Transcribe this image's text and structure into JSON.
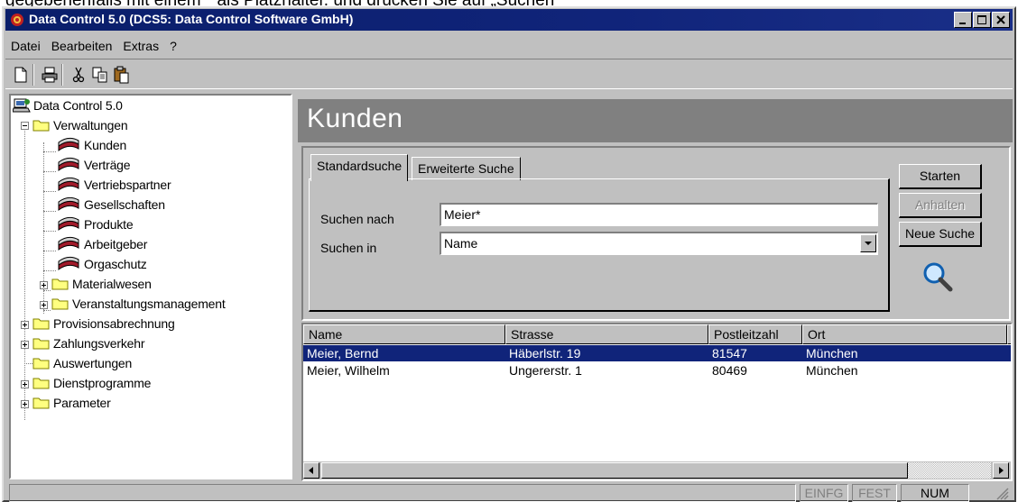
{
  "caption_fragment": "gegebenenfalls mit einem * als Platzhalter. und drücken Sie auf „Suchen“",
  "window": {
    "title": "Data Control 5.0 (DCS5: Data Control Software GmbH)"
  },
  "menu": {
    "items": [
      {
        "label": "Datei"
      },
      {
        "label": "Bearbeiten"
      },
      {
        "label": "Extras"
      },
      {
        "label": "?"
      }
    ]
  },
  "toolbar": {
    "icons": [
      "new-document-icon",
      "print-icon",
      "cut-icon",
      "copy-icon",
      "paste-icon"
    ]
  },
  "tree": {
    "root": "Data Control 5.0",
    "verwaltungen": "Verwaltungen",
    "verwaltungen_children": [
      "Kunden",
      "Verträge",
      "Vertriebspartner",
      "Gesellschaften",
      "Produkte",
      "Arbeitgeber",
      "Orgaschutz"
    ],
    "materialwesen": "Materialwesen",
    "veranstaltungsmanagement": "Veranstaltungsmanagement",
    "top_level": [
      "Provisionsabrechnung",
      "Zahlungsverkehr",
      "Auswertungen",
      "Dienstprogramme",
      "Parameter"
    ]
  },
  "header": {
    "title": "Kunden"
  },
  "search": {
    "tabs": [
      "Standardsuche",
      "Erweiterte Suche"
    ],
    "active_tab": "Standardsuche",
    "search_for_label": "Suchen nach",
    "search_for_value": "Meier*",
    "search_in_label": "Suchen in",
    "search_in_value": "Name",
    "buttons": {
      "start": "Starten",
      "stop": "Anhalten",
      "new_search": "Neue Suche"
    }
  },
  "results": {
    "columns": [
      "Name",
      "Strasse",
      "Postleitzahl",
      "Ort"
    ],
    "rows": [
      {
        "name": "Meier, Bernd",
        "street": "Häberlstr. 19",
        "zip": "81547",
        "city": "München",
        "selected": true
      },
      {
        "name": "Meier, Wilhelm",
        "street": "Ungererstr. 1",
        "zip": "80469",
        "city": "München",
        "selected": false
      }
    ]
  },
  "status": {
    "insert": "EINFG",
    "caps": "FEST",
    "num": "NUM"
  },
  "colors": {
    "title_bar": "#0a1e6a",
    "selection": "#10247a",
    "face": "#c0c0c0",
    "banner": "#808080"
  }
}
